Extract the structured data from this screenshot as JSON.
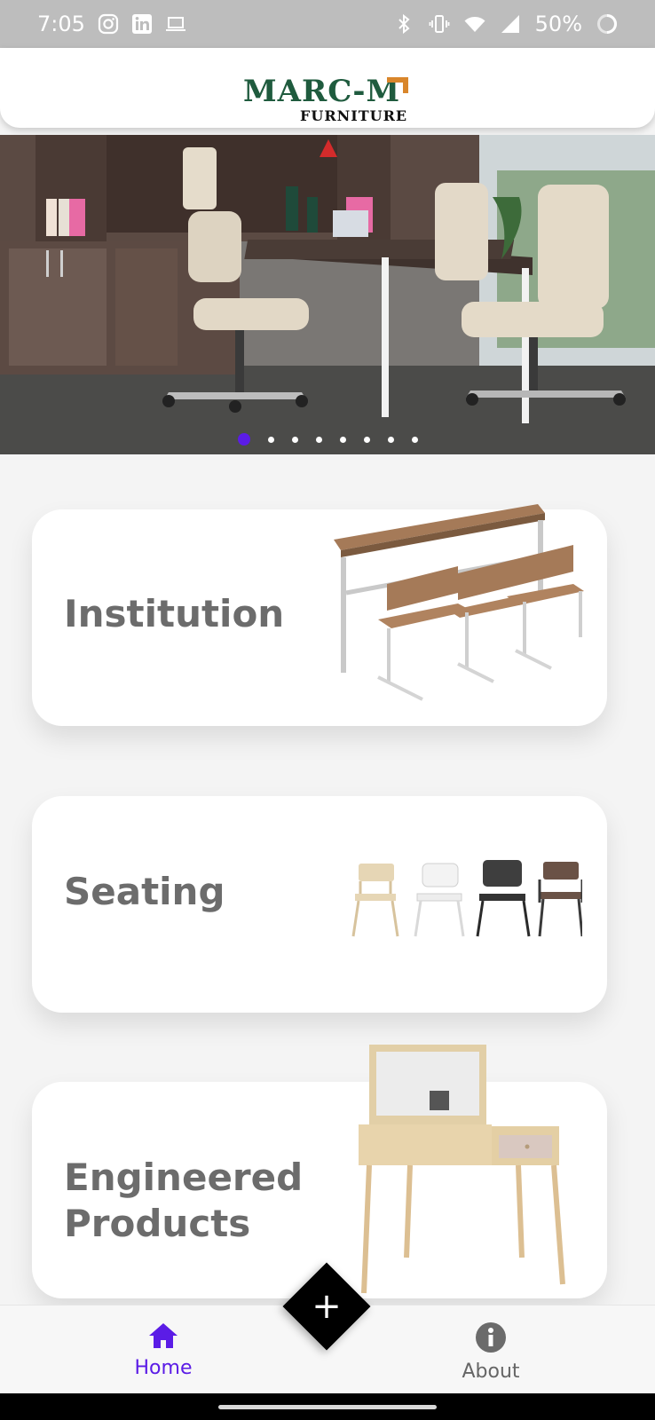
{
  "status_bar": {
    "time": "7:05",
    "left_icons": [
      "instagram-icon",
      "linkedin-icon",
      "laptop-icon"
    ],
    "right_icons": [
      "bluetooth-icon",
      "vibrate-icon",
      "wifi-icon",
      "signal-icon"
    ],
    "battery": "50%"
  },
  "app_bar": {
    "logo_text": "MARC-M",
    "logo_subtext": "FURNITURE"
  },
  "carousel": {
    "slide_count": 8,
    "active_index": 0
  },
  "categories": [
    {
      "title": "Institution"
    },
    {
      "title": "Seating"
    },
    {
      "title": "Engineered\nProducts"
    }
  ],
  "bottom_nav": {
    "home_label": "Home",
    "about_label": "About",
    "fab_symbol": "+"
  },
  "colors": {
    "accent": "#5b1ce6",
    "logo_green": "#1f5b3e",
    "logo_orange": "#d9862b",
    "card_text": "#6c6c6c"
  }
}
